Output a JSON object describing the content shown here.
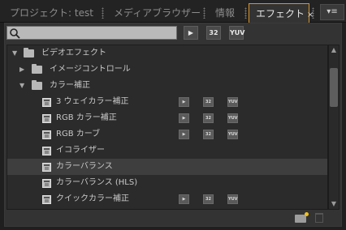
{
  "tabs": [
    {
      "label": "プロジェクト: test"
    },
    {
      "label": "メディアブラウザー"
    },
    {
      "label": "情報"
    },
    {
      "label": "エフェクト",
      "close": "×"
    }
  ],
  "panel_menu": {
    "label": "▾≡"
  },
  "toolbar": {
    "search": {
      "value": "",
      "placeholder": ""
    },
    "accelerated_label": "▶",
    "bit32_label": "32",
    "yuv_label": "YUV"
  },
  "tree": [
    {
      "type": "folder",
      "label": "ビデオエフェクト",
      "expanded": true
    },
    {
      "type": "folder",
      "label": "イメージコントロール",
      "expanded": false
    },
    {
      "type": "folder",
      "label": "カラー補正",
      "expanded": true
    },
    {
      "type": "effect",
      "label": "3 ウェイカラー補正",
      "badges": [
        "▶",
        "32",
        "YUV"
      ]
    },
    {
      "type": "effect",
      "label": "RGB カラー補正",
      "badges": [
        "▶",
        "32",
        "YUV"
      ]
    },
    {
      "type": "effect",
      "label": "RGB カーブ",
      "badges": [
        "▶",
        "32",
        "YUV"
      ]
    },
    {
      "type": "effect",
      "label": "イコライザー",
      "badges": []
    },
    {
      "type": "effect",
      "label": "カラーバランス",
      "badges": [],
      "selected": true
    },
    {
      "type": "effect",
      "label": "カラーバランス (HLS)",
      "badges": []
    },
    {
      "type": "effect",
      "label": "クイックカラー補正",
      "badges": [
        "▶",
        "32",
        "YUV"
      ]
    }
  ],
  "scrollbar": {
    "up": "▲",
    "down": "▼"
  }
}
